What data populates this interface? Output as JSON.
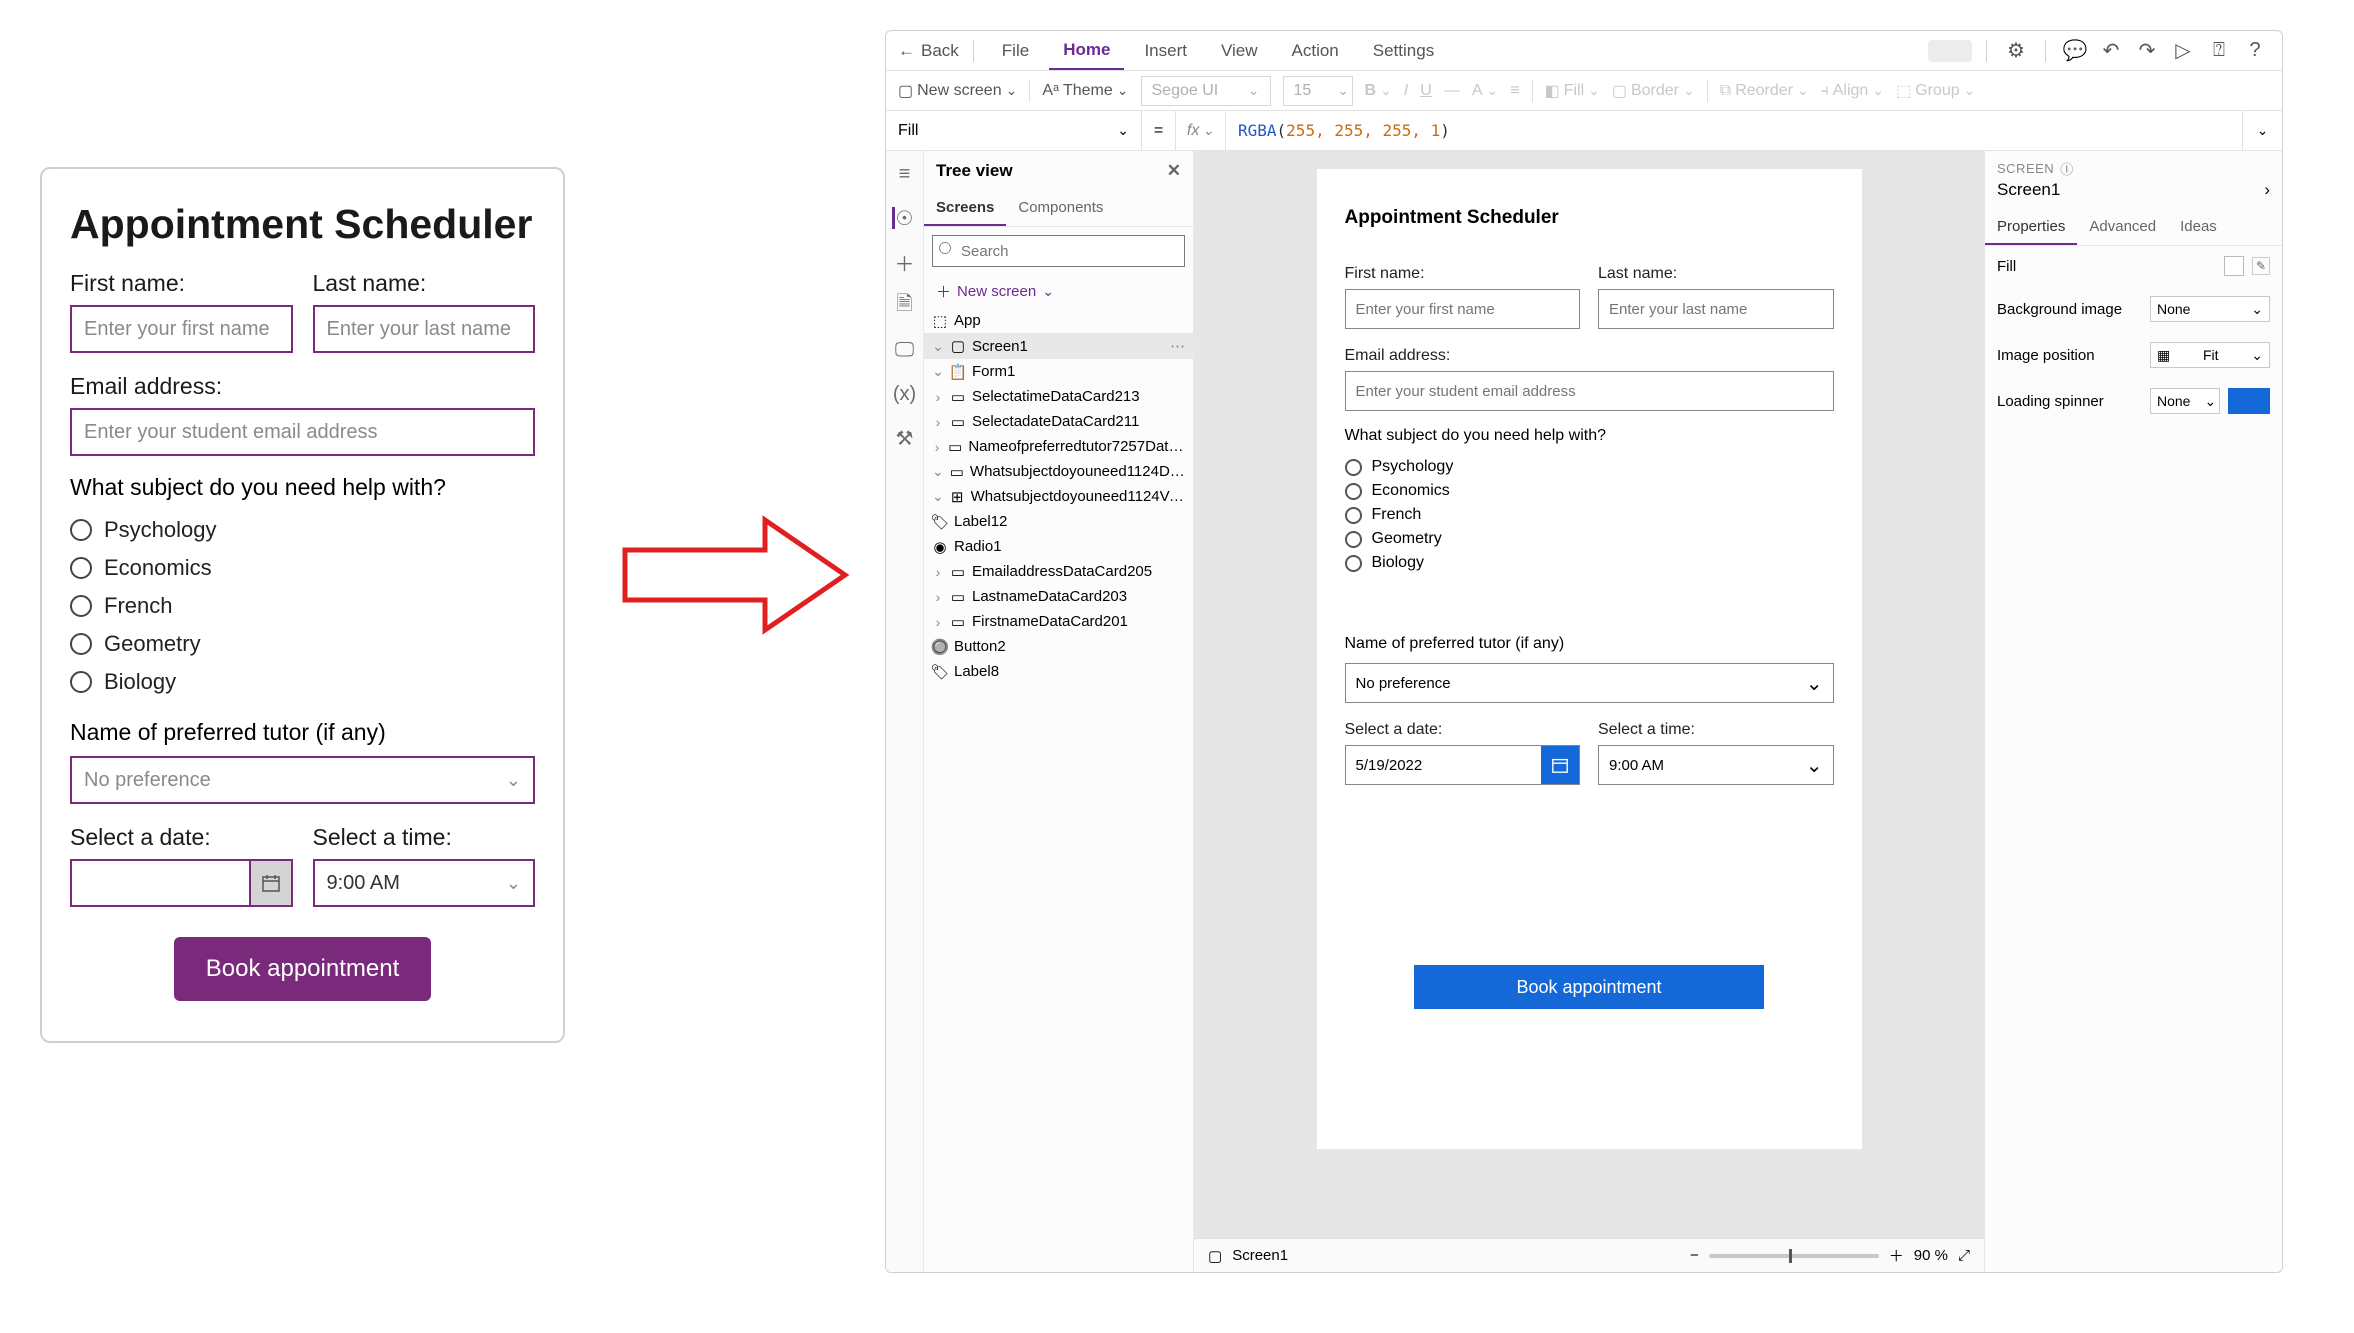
{
  "mockup": {
    "title": "Appointment Scheduler",
    "first_label": "First name:",
    "last_label": "Last name:",
    "first_ph": "Enter your first name",
    "last_ph": "Enter your last name",
    "email_label": "Email address:",
    "email_ph": "Enter your student email address",
    "subject_q": "What subject do you need help with?",
    "subjects": [
      "Psychology",
      "Economics",
      "French",
      "Geometry",
      "Biology"
    ],
    "tutor_label": "Name of preferred tutor (if any)",
    "tutor_value": "No preference",
    "date_label": "Select a date:",
    "time_label": "Select a time:",
    "time_value": "9:00 AM",
    "book": "Book appointment"
  },
  "studio": {
    "back": "Back",
    "menu": {
      "file": "File",
      "home": "Home",
      "insert": "Insert",
      "view": "View",
      "action": "Action",
      "settings": "Settings"
    },
    "ribbon": {
      "new_screen": "New screen",
      "theme": "Theme",
      "font": "Segoe UI",
      "size": "15",
      "fill": "Fill",
      "border": "Border",
      "reorder": "Reorder",
      "align": "Align",
      "group": "Group"
    },
    "formula": {
      "property": "Fill",
      "fn": "RGBA",
      "args": "255,  255,  255,  1"
    },
    "tree": {
      "title": "Tree view",
      "tab_screens": "Screens",
      "tab_components": "Components",
      "search_ph": "Search",
      "new_screen": "New screen",
      "nodes": {
        "app": "App",
        "screen1": "Screen1",
        "form1": "Form1",
        "selecttime": "SelectatimeDataCard213",
        "selectdate": "SelectadateDataCard211",
        "tutor": "Nameofpreferredtutor7257DataCard…",
        "subject": "Whatsubjectdoyouneed1124DataCar…",
        "subjectvert": "Whatsubjectdoyouneed1124Vert…",
        "label12": "Label12",
        "radio1": "Radio1",
        "email": "EmailaddressDataCard205",
        "lastname": "LastnameDataCard203",
        "firstname": "FirstnameDataCard201",
        "button2": "Button2",
        "label8": "Label8"
      }
    },
    "canvas": {
      "title": "Appointment Scheduler",
      "first_label": "First name:",
      "last_label": "Last name:",
      "first_ph": "Enter your first name",
      "last_ph": "Enter your last name",
      "email_label": "Email address:",
      "email_ph": "Enter your student email address",
      "subject_q": "What subject do you need help with?",
      "subjects": [
        "Psychology",
        "Economics",
        "French",
        "Geometry",
        "Biology"
      ],
      "tutor_label": "Name of preferred tutor (if any)",
      "tutor_value": "No preference",
      "date_label": "Select a date:",
      "date_value": "5/19/2022",
      "time_label": "Select a time:",
      "time_value": "9:00 AM",
      "book": "Book appointment"
    },
    "footer": {
      "screen": "Screen1",
      "zoom": "90 %"
    },
    "props": {
      "crumb": "SCREEN",
      "name": "Screen1",
      "tab_props": "Properties",
      "tab_adv": "Advanced",
      "tab_ideas": "Ideas",
      "fill": "Fill",
      "bg_image": "Background image",
      "bg_image_val": "None",
      "img_pos": "Image position",
      "img_pos_val": "Fit",
      "spinner": "Loading spinner",
      "spinner_val": "None"
    }
  }
}
